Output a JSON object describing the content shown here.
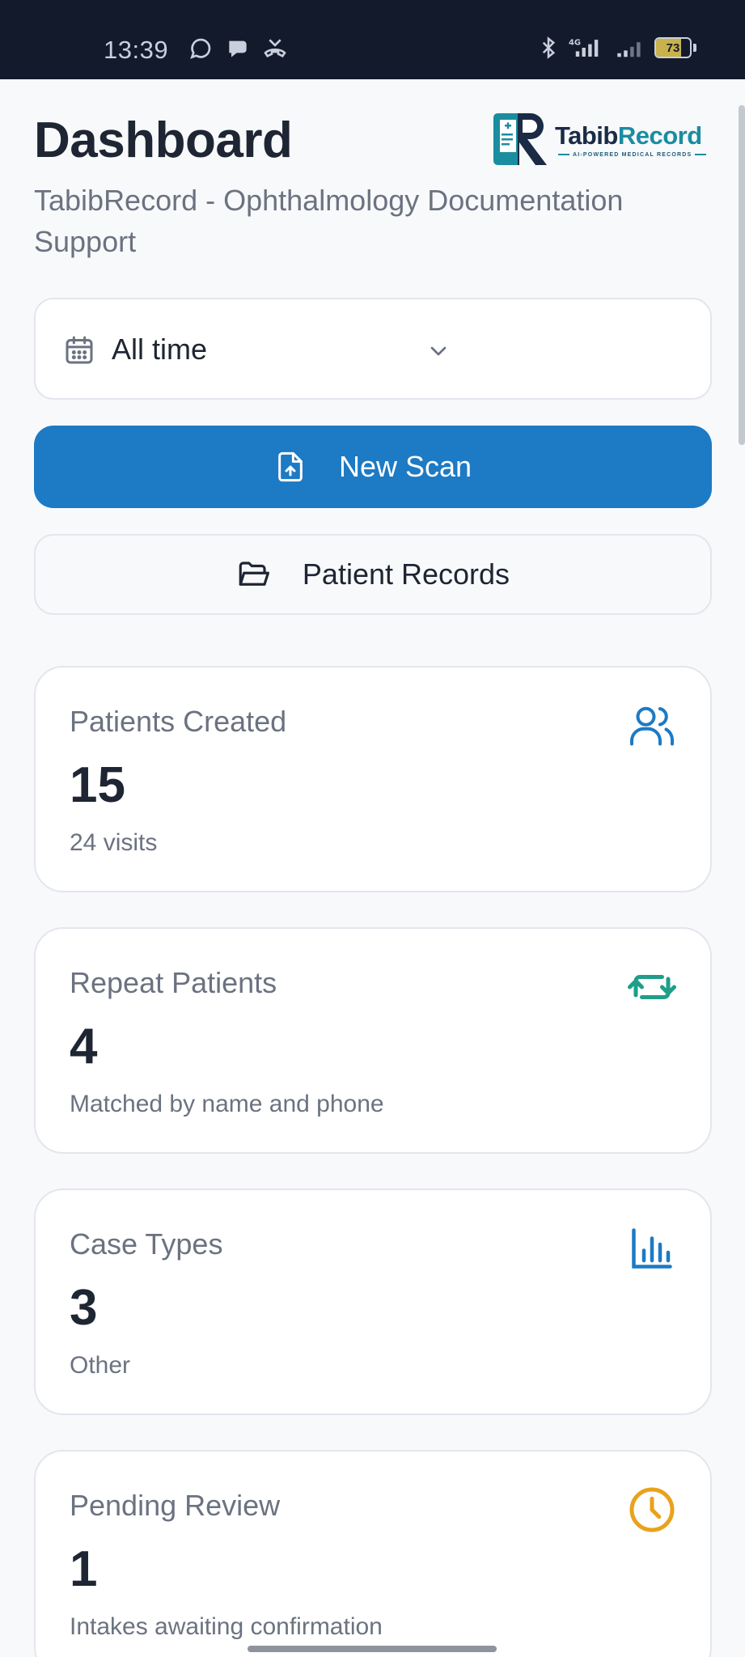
{
  "status_bar": {
    "time": "13:39",
    "network": "4G",
    "battery": "73"
  },
  "header": {
    "title": "Dashboard",
    "subtitle": "TabibRecord - Ophthalmology Documentation Support",
    "logo": {
      "name_part1": "Tabib",
      "name_part2": "Record",
      "tagline": "AI-POWERED MEDICAL RECORDS"
    }
  },
  "filter": {
    "selected": "All time"
  },
  "actions": {
    "new_scan": "New Scan",
    "patient_records": "Patient Records"
  },
  "stats": [
    {
      "label": "Patients Created",
      "value": "15",
      "sub": "24 visits",
      "icon": "users-icon",
      "color": "#1d7ac4"
    },
    {
      "label": "Repeat Patients",
      "value": "4",
      "sub": "Matched by name and phone",
      "icon": "repeat-icon",
      "color": "#1f9e8a"
    },
    {
      "label": "Case Types",
      "value": "3",
      "sub": "Other",
      "icon": "bar-chart-icon",
      "color": "#1d7ac4"
    },
    {
      "label": "Pending Review",
      "value": "1",
      "sub": "Intakes awaiting confirmation",
      "icon": "clock-icon",
      "color": "#e9a21c"
    }
  ]
}
